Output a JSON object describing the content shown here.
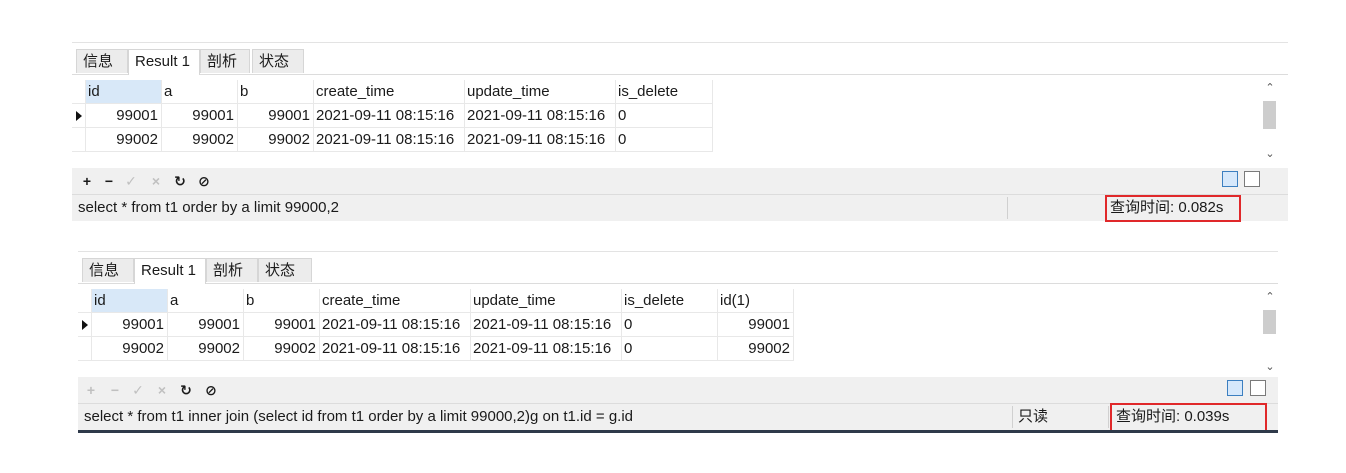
{
  "panel1": {
    "tabs": [
      "信息",
      "Result 1",
      "剖析",
      "状态"
    ],
    "columns": [
      "id",
      "a",
      "b",
      "create_time",
      "update_time",
      "is_delete"
    ],
    "rows": [
      [
        "99001",
        "99001",
        "99001",
        "2021-09-11 08:15:16",
        "2021-09-11 08:15:16",
        "0"
      ],
      [
        "99002",
        "99002",
        "99002",
        "2021-09-11 08:15:16",
        "2021-09-11 08:15:16",
        "0"
      ]
    ],
    "sql": "select * from t1 order by a limit 99000,2",
    "query_time": "查询时间: 0.082s"
  },
  "panel2": {
    "tabs": [
      "信息",
      "Result 1",
      "剖析",
      "状态"
    ],
    "columns": [
      "id",
      "a",
      "b",
      "create_time",
      "update_time",
      "is_delete",
      "id(1)"
    ],
    "rows": [
      [
        "99001",
        "99001",
        "99001",
        "2021-09-11 08:15:16",
        "2021-09-11 08:15:16",
        "0",
        "99001"
      ],
      [
        "99002",
        "99002",
        "99002",
        "2021-09-11 08:15:16",
        "2021-09-11 08:15:16",
        "0",
        "99002"
      ]
    ],
    "sql": "select * from t1 inner join (select id from t1 order by a limit 99000,2)g on t1.id = g.id",
    "readonly": "只读",
    "query_time": "查询时间: 0.039s"
  },
  "toolbar_icons": [
    "add-icon",
    "delete-icon",
    "apply-icon",
    "discard-icon",
    "refresh-icon",
    "stop-icon"
  ],
  "colors": {
    "highlight": "#e0282a",
    "header_selected": "#d8e8f8",
    "toolbar_bg": "#f0f0f0"
  }
}
